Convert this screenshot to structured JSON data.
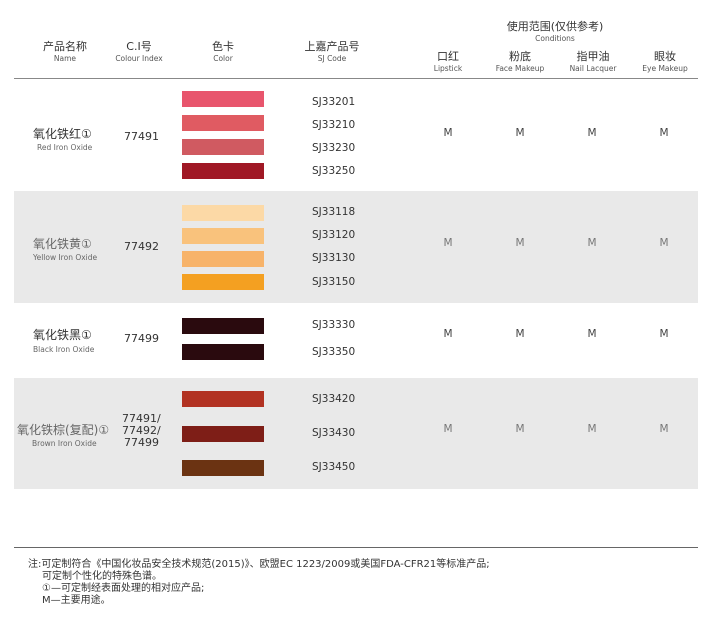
{
  "header": {
    "name_cn": "产品名称",
    "name_en": "Name",
    "ci_cn": "C.I号",
    "ci_en": "Colour Index",
    "color_cn": "色卡",
    "color_en": "Color",
    "code_cn": "上嘉产品号",
    "code_en": "SJ Code",
    "conditions_cn": "使用范围(仅供参考)",
    "conditions_en": "Conditions",
    "lipstick_cn": "口红",
    "lipstick_en": "Lipstick",
    "face_cn": "粉底",
    "face_en": "Face Makeup",
    "nail_cn": "指甲油",
    "nail_en": "Nail Lacquer",
    "eye_cn": "眼妆",
    "eye_en": "Eye Makeup"
  },
  "groups": [
    {
      "name_cn": "氧化铁红①",
      "name_en": "Red Iron Oxide",
      "ci": "77491",
      "swatches": [
        {
          "color": "#e8556d",
          "code": "SJ33201"
        },
        {
          "color": "#e05b62",
          "code": "SJ33210"
        },
        {
          "color": "#d05a61",
          "code": "SJ33230"
        },
        {
          "color": "#a01825",
          "code": "SJ33250"
        }
      ],
      "usage": [
        "M",
        "M",
        "M",
        "M"
      ]
    },
    {
      "name_cn": "氧化铁黄①",
      "name_en": "Yellow Iron Oxide",
      "ci": "77492",
      "swatches": [
        {
          "color": "#fcd9a6",
          "code": "SJ33118"
        },
        {
          "color": "#f9c27c",
          "code": "SJ33120"
        },
        {
          "color": "#f7b36a",
          "code": "SJ33130"
        },
        {
          "color": "#f4a021",
          "code": "SJ33150"
        }
      ],
      "usage": [
        "M",
        "M",
        "M",
        "M"
      ]
    },
    {
      "name_cn": "氧化铁黑①",
      "name_en": "Black Iron Oxide",
      "ci": "77499",
      "swatches": [
        {
          "color": "#2a0a0e",
          "code": "SJ33330"
        },
        {
          "color": "#2a0a0e",
          "code": "SJ33350"
        }
      ],
      "usage": [
        "M",
        "M",
        "M",
        "M"
      ]
    },
    {
      "name_cn": "氧化铁棕(复配)①",
      "name_en": "Brown Iron Oxide",
      "ci_lines": [
        "77491/",
        "77492/",
        "77499"
      ],
      "swatches": [
        {
          "color": "#b23222",
          "code": "SJ33420"
        },
        {
          "color": "#7e1e17",
          "code": "SJ33430"
        },
        {
          "color": "#6b3312",
          "code": "SJ33450"
        }
      ],
      "usage": [
        "M",
        "M",
        "M",
        "M"
      ]
    }
  ],
  "notes": [
    "注:可定制符合《中国化妆品安全技术规范(2015)》、欧盟EC 1223/2009或美国FDA-CFR21等标准产品;",
    "可定制个性化的特殊色谱。",
    "①—可定制经表面处理的相对应产品;",
    "M—主要用途。"
  ]
}
